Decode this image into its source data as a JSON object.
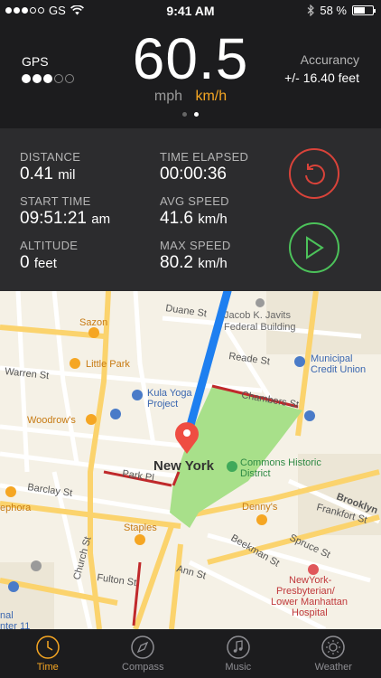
{
  "status": {
    "carrier": "GS",
    "time": "9:41 AM",
    "battery": "58 %"
  },
  "header": {
    "gps_label": "GPS",
    "speed": "60.5",
    "unit_mph": "mph",
    "unit_kmh": "km/h",
    "accuracy_label": "Accurancy",
    "accuracy_value": "+/- 16.40 feet"
  },
  "stats": {
    "distance": {
      "label": "DISTANCE",
      "value": "0.41",
      "unit": "mil"
    },
    "time_elapsed": {
      "label": "TIME ELAPSED",
      "value": "00:00:36"
    },
    "start_time": {
      "label": "START TIME",
      "value": "09:51:21",
      "unit": "am"
    },
    "avg_speed": {
      "label": "AVG SPEED",
      "value": "41.6",
      "unit": "km/h"
    },
    "altitude": {
      "label": "ALTITUDE",
      "value": "0",
      "unit": "feet"
    },
    "max_speed": {
      "label": "MAX SPEED",
      "value": "80.2",
      "unit": "km/h"
    }
  },
  "map": {
    "labels": {
      "duane": "Duane St",
      "javits1": "Jacob K. Javits",
      "javits2": "Federal Building",
      "sazon": "Sazon",
      "municipal1": "Municipal",
      "municipal2": "Credit Union",
      "little_park": "Little Park",
      "reade": "Reade St",
      "warren": "Warren St",
      "kula1": "Kula Yoga",
      "kula2": "Project",
      "chambers": "Chambers St",
      "woodrows": "Woodrow's",
      "newyork": "New York",
      "commons1": "Commons Historic",
      "commons2": "District",
      "parkpl": "Park Pl",
      "barclay": "Barclay St",
      "ephora": "ephora",
      "brooklyn": "Brooklyn",
      "frankfort": "Frankfort St",
      "dennys": "Denny's",
      "staples": "Staples",
      "spruce": "Spruce St",
      "beekman": "Beekman St",
      "church": "Church St",
      "ann": "Ann St",
      "fulton": "Fulton St",
      "nyp1": "NewYork-",
      "nyp2": "Presbyterian/",
      "nyp3": "Lower Manhattan",
      "nyp4": "Hospital",
      "nal": "nal",
      "nter": "nter 11"
    }
  },
  "tabs": [
    {
      "label": "Time",
      "icon": "clock-icon",
      "active": true
    },
    {
      "label": "Compass",
      "icon": "compass-icon",
      "active": false
    },
    {
      "label": "Music",
      "icon": "music-icon",
      "active": false
    },
    {
      "label": "Weather",
      "icon": "sun-icon",
      "active": false
    }
  ],
  "colors": {
    "accent": "#f5a623",
    "reset": "#d9433a",
    "play": "#4cc25a",
    "route": "#1e7ff0",
    "park": "#a8e08a"
  }
}
